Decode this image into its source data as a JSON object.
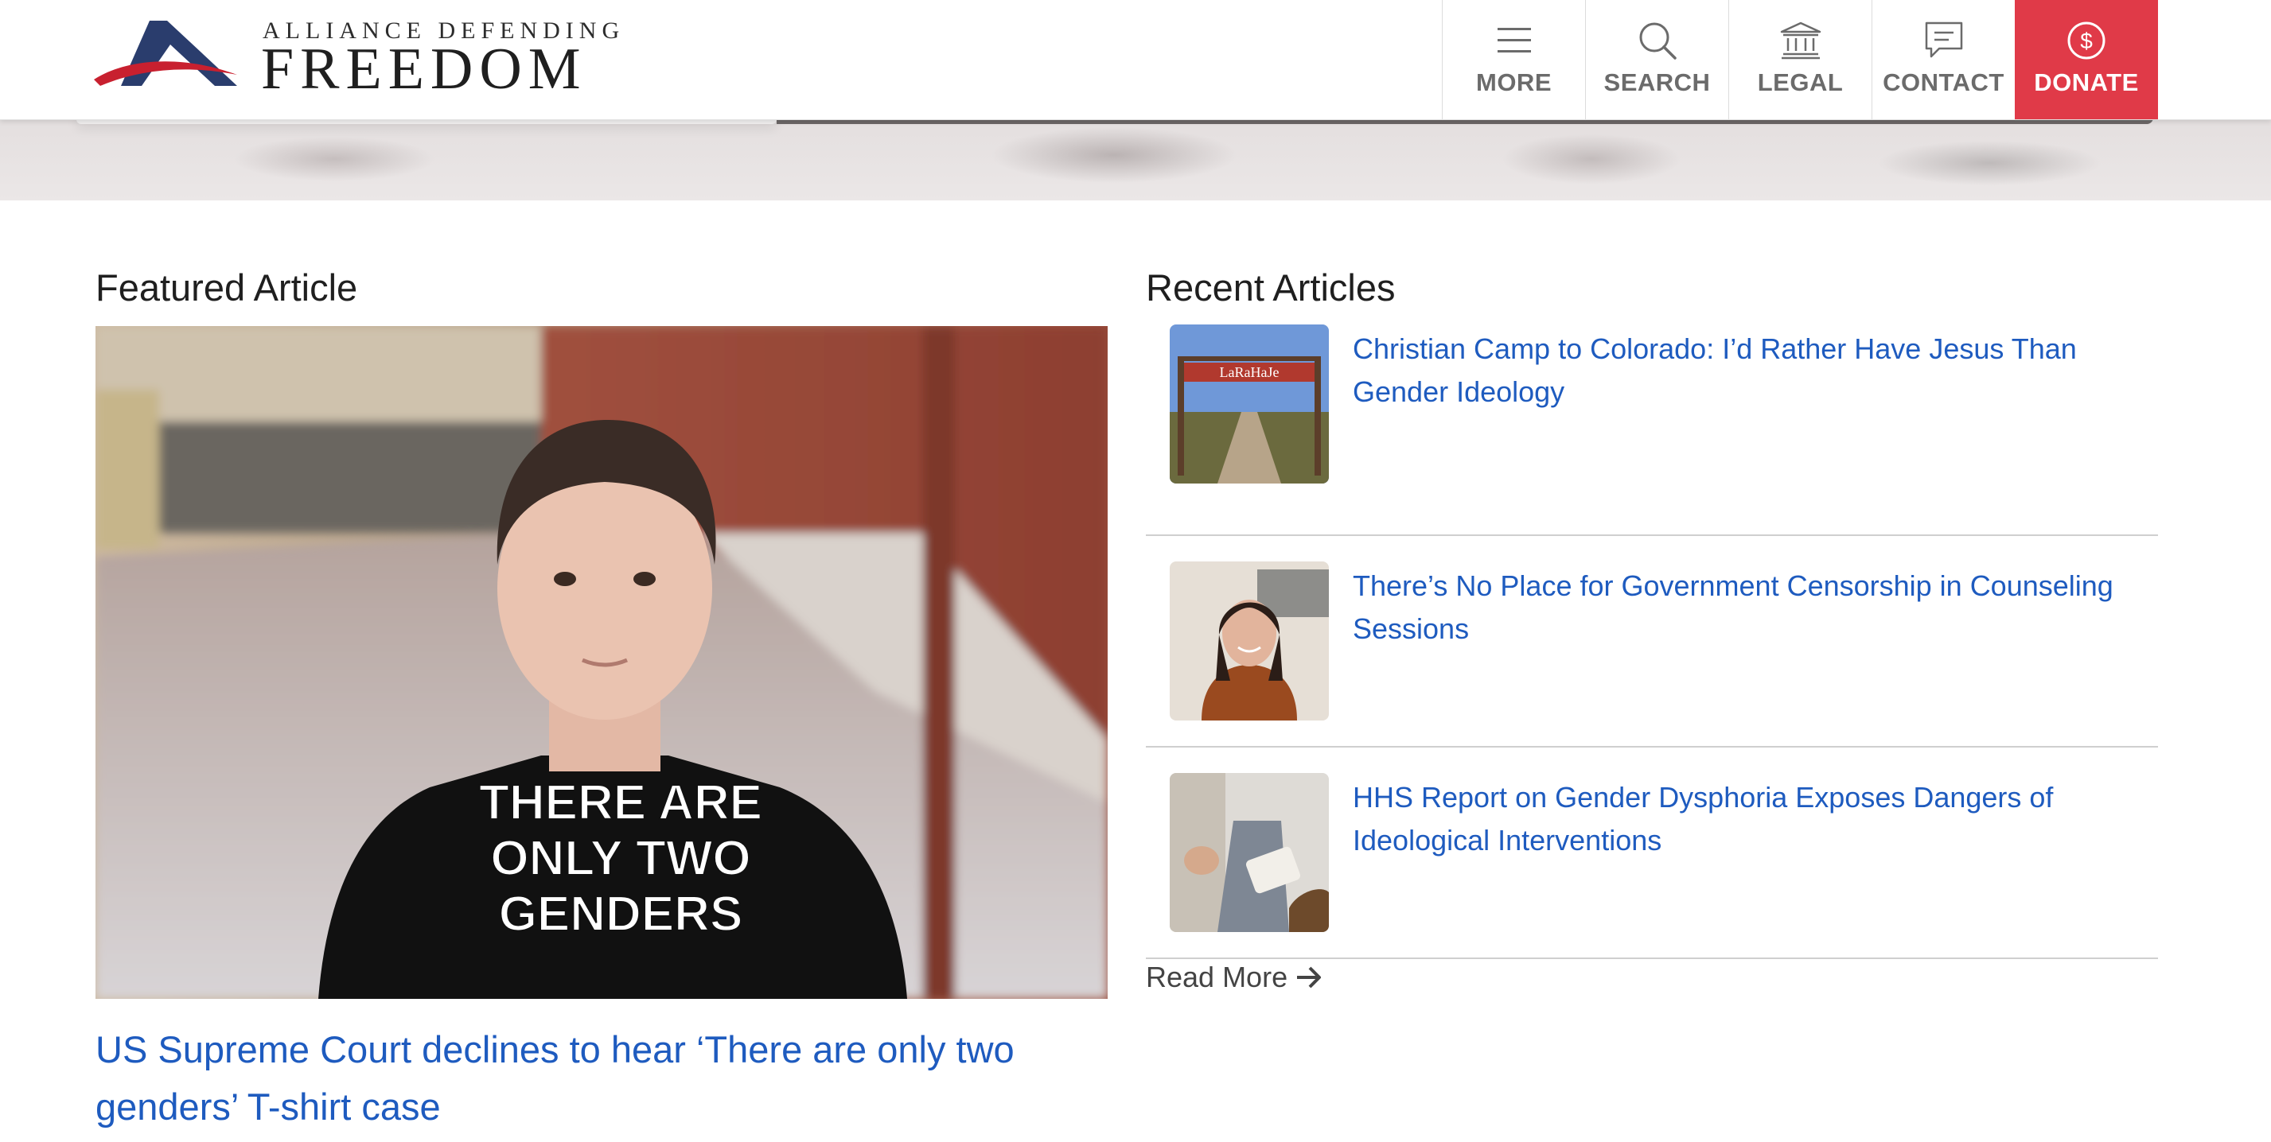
{
  "logo": {
    "top_line": "ALLIANCE DEFENDING",
    "main_line": "FREEDOM"
  },
  "nav": {
    "more": "MORE",
    "search": "SEARCH",
    "legal": "LEGAL",
    "contact": "CONTACT",
    "donate": "DONATE"
  },
  "colors": {
    "link": "#1e5bbf",
    "donate": "#e03a48",
    "logo_blue": "#2a3d6d",
    "logo_red": "#c8202f"
  },
  "featured": {
    "heading": "Featured Article",
    "shirt_text": [
      "THERE ARE",
      "ONLY TWO",
      "GENDERS"
    ],
    "title": "US Supreme Court declines to hear ‘There are only two genders’ T-shirt case"
  },
  "recent": {
    "heading": "Recent Articles",
    "items": [
      {
        "title": "Christian Camp to Colorado: I’d Rather Have Jesus Than Gender Ideology",
        "thumb_sign": "LaRaHaJe"
      },
      {
        "title": "There’s No Place for Government Censorship in Counseling Sessions"
      },
      {
        "title": "HHS Report on Gender Dysphoria Exposes Dangers of Ideological Interventions"
      }
    ],
    "read_more": "Read More"
  }
}
